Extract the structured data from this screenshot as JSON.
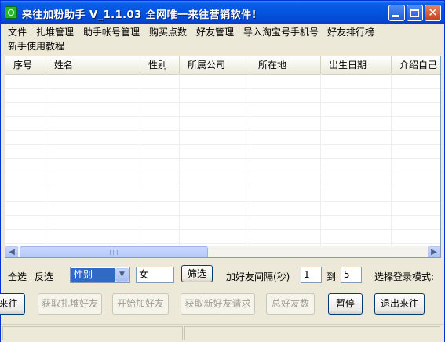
{
  "window": {
    "title": "来往加粉助手  V_1.1.03  全网唯一来往营销软件!",
    "close_glyph": "✕"
  },
  "menu": {
    "items": [
      "文件",
      "扎堆管理",
      "助手帐号管理",
      "购买点数",
      "好友管理",
      "导入淘宝号手机号",
      "好友排行榜",
      "新手使用教程"
    ]
  },
  "grid": {
    "columns": [
      "序号",
      "姓名",
      "性别",
      "所属公司",
      "所在地",
      "出生日期",
      "介绍自己"
    ],
    "rows": []
  },
  "scrollbar": {
    "left_glyph": "◀",
    "right_glyph": "▶"
  },
  "filter": {
    "select_all": "全选",
    "invert": "反选",
    "field_selected": "性别",
    "dropdown_glyph": "▼",
    "field_value": "女",
    "filter_button": "筛选",
    "interval_label": "加好友间隔(秒)",
    "interval_from": "1",
    "to_label": "到",
    "interval_to": "5",
    "login_mode_label": "选择登录模式:"
  },
  "actions": {
    "login_partial": "来往",
    "fetch_group_friends": "获取扎堆好友",
    "start_adding": "开始加好友",
    "fetch_new_requests": "获取新好友请求",
    "total_friends": "总好友数",
    "pause": "暂停",
    "exit": "退出来往"
  }
}
